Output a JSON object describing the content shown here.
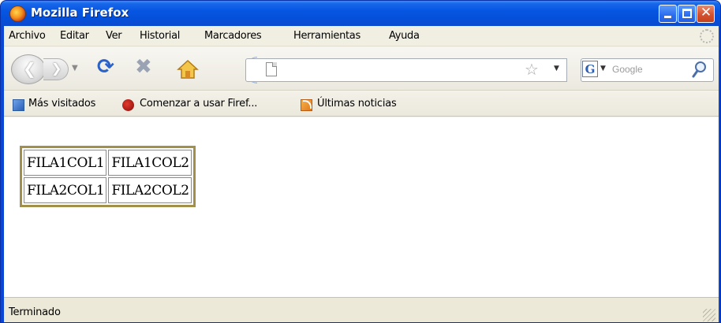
{
  "window": {
    "title": "Mozilla Firefox"
  },
  "menu": {
    "items": [
      {
        "label": "Archivo"
      },
      {
        "label": "Editar"
      },
      {
        "label": "Ver"
      },
      {
        "label": "Historial"
      },
      {
        "label": "Marcadores"
      },
      {
        "label": "Herramientas"
      },
      {
        "label": "Ayuda"
      }
    ]
  },
  "navbar": {
    "url_value": "",
    "search_engine": "G",
    "search_placeholder": "Google",
    "icons": [
      "back-icon",
      "forward-icon",
      "reload-icon",
      "stop-icon",
      "home-icon",
      "page-icon",
      "star-icon",
      "search-icon"
    ]
  },
  "bookmarks": {
    "items": [
      {
        "label": "Más visitados",
        "icon": "smart-bookmark-icon"
      },
      {
        "label": "Comenzar a usar Firef...",
        "icon": "firefox-icon"
      },
      {
        "label": "Últimas noticias",
        "icon": "rss-icon"
      }
    ]
  },
  "content": {
    "table": {
      "rows": [
        [
          "FILA1COL1",
          "FILA1COL2"
        ],
        [
          "FILA2COL1",
          "FILA2COL2"
        ]
      ],
      "border_color": "#a2904a"
    }
  },
  "status": {
    "text": "Terminado"
  },
  "colors": {
    "titlebar": "#0656e3",
    "chrome": "#ece9d8",
    "reload": "#2a62c8"
  }
}
